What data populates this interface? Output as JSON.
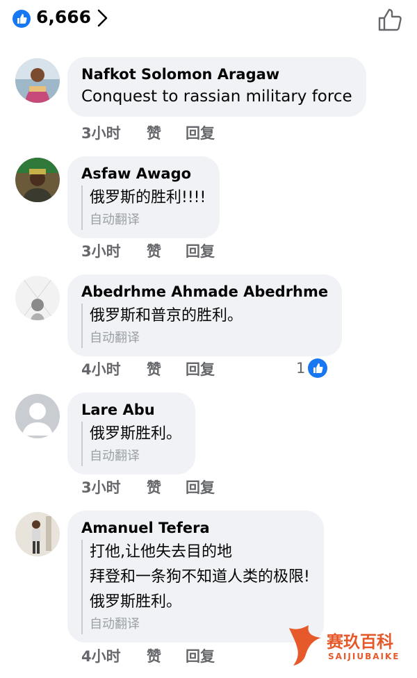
{
  "header": {
    "like_count": "6,666",
    "like_icon": "thumbs-up-badge-icon",
    "chevron_icon": "chevron-right-icon",
    "like_button_icon": "thumbs-up-outline-icon",
    "accent": "#1877f2"
  },
  "comments": [
    {
      "author": "Nafkot Solomon Aragaw",
      "text": "Conquest to rassian military force",
      "time": "3小时",
      "like_label": "赞",
      "reply_label": "回复"
    },
    {
      "author": "Asfaw Awago",
      "translated": [
        "俄罗斯的胜利!!!!"
      ],
      "translate_label": "自动翻译",
      "time": "3小时",
      "like_label": "赞",
      "reply_label": "回复"
    },
    {
      "author": "Abedrhme Ahmade Abedrhme",
      "translated": [
        "俄罗斯和普京的胜利。"
      ],
      "translate_label": "自动翻译",
      "time": "4小时",
      "like_label": "赞",
      "reply_label": "回复",
      "reaction_count": "1"
    },
    {
      "author": "Lare Abu",
      "translated": [
        "俄罗斯胜利。"
      ],
      "translate_label": "自动翻译",
      "time": "3小时",
      "like_label": "赞",
      "reply_label": "回复"
    },
    {
      "author": "Amanuel Tefera",
      "translated": [
        "打他,让他失去目的地",
        "拜登和一条狗不知道人类的极限!",
        "俄罗斯胜利。"
      ],
      "translate_label": "自动翻译",
      "time": "4小时",
      "like_label": "赞",
      "reply_label": "回复"
    }
  ],
  "watermark": {
    "title": "赛玖百科",
    "subtitle": "SAIJIUBAIKE",
    "color": "#e6592b"
  }
}
